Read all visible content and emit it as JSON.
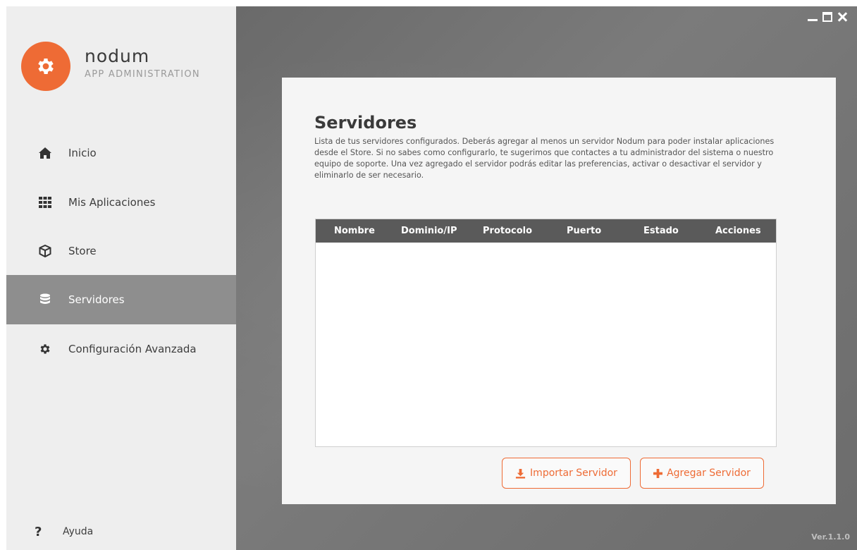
{
  "app": {
    "name": "nodum",
    "subtitle": "APP ADMINISTRATION",
    "version": "Ver.1.1.0",
    "accent": "#ee6b35"
  },
  "sidebar": {
    "items": [
      {
        "label": "Inicio",
        "icon": "home-icon"
      },
      {
        "label": "Mis Aplicaciones",
        "icon": "grid-icon"
      },
      {
        "label": "Store",
        "icon": "box-icon"
      },
      {
        "label": "Servidores",
        "icon": "database-icon",
        "active": true
      },
      {
        "label": "Configuración Avanzada",
        "icon": "gear-icon"
      }
    ],
    "help": {
      "label": "Ayuda",
      "icon": "question-icon"
    }
  },
  "page": {
    "title": "Servidores",
    "description": "Lista de tus servidores configurados. Deberás agregar al menos un servidor Nodum para poder instalar aplicaciones desde el Store. Si no sabes como configurarlo, te sugerimos que contactes a tu administrador del sistema o nuestro equipo de soporte. Una vez agregado el servidor podrás editar las preferencias, activar o desactivar el servidor y eliminarlo de ser necesario."
  },
  "table": {
    "columns": [
      "Nombre",
      "Dominio/IP",
      "Protocolo",
      "Puerto",
      "Estado",
      "Acciones"
    ],
    "rows": []
  },
  "actions": {
    "import_label": "Importar Servidor",
    "add_label": "Agregar Servidor"
  }
}
